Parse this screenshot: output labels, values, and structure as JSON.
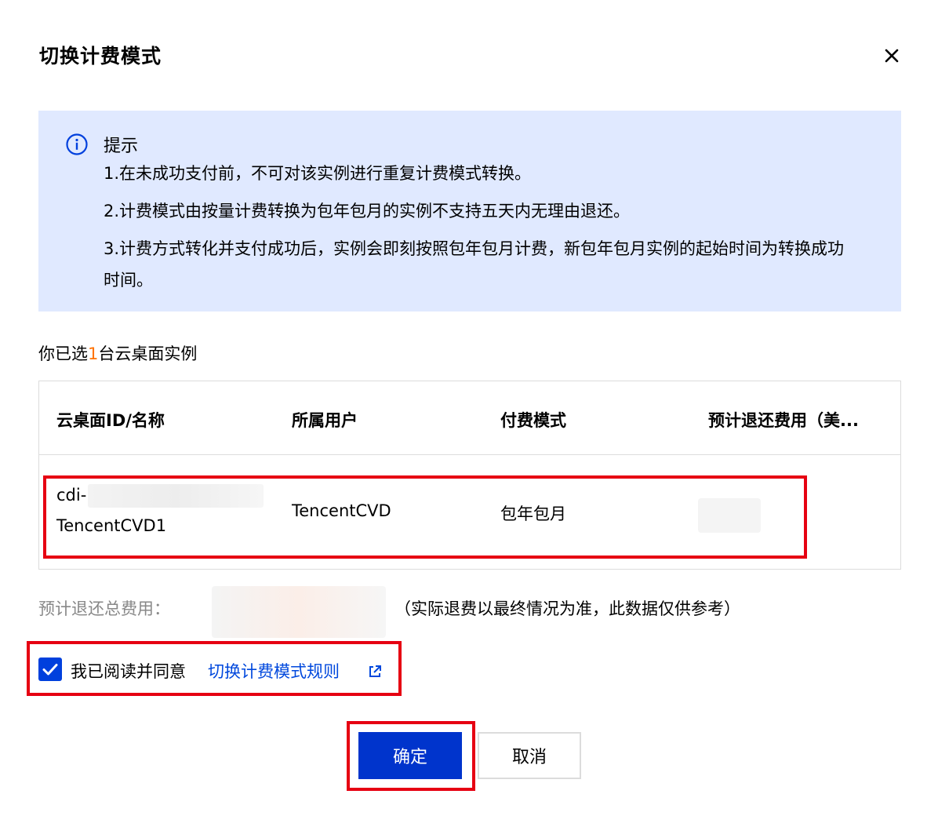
{
  "dialog": {
    "title": "切换计费模式",
    "close_icon": "close-icon"
  },
  "notice": {
    "icon": "info-icon",
    "title": "提示",
    "lines": [
      "1.在未成功支付前，不可对该实例进行重复计费模式转换。",
      "2.计费模式由按量计费转换为包年包月的实例不支持五天内无理由退还。",
      "3.计费方式转化并支付成功后，实例会即刻按照包年包月计费，新包年包月实例的起始时间为转换成功时间。"
    ],
    "background": "#e0e9ff"
  },
  "selection": {
    "prefix": "你已选",
    "count": "1",
    "suffix": "台云桌面实例",
    "count_color": "#ff7200"
  },
  "table": {
    "columns": [
      "云桌面ID/名称",
      "所属用户",
      "付费模式",
      "预计退还费用（美..."
    ],
    "rows": [
      {
        "id": "cdi-",
        "name": "TencentCVD1",
        "user": "TencentCVD",
        "billing_mode": "包年包月",
        "refund": ""
      }
    ]
  },
  "total": {
    "label": "预计退还总费用：",
    "note": "（实际退费以最终情况为准，此数据仅供参考）"
  },
  "agreement": {
    "checked": true,
    "text": "我已阅读并同意",
    "link_text": "切换计费模式规则",
    "link_icon": "external-link-icon"
  },
  "buttons": {
    "confirm": "确定",
    "cancel": "取消"
  },
  "colors": {
    "primary": "#0034cc",
    "link": "#0048dd",
    "highlight": "#e60012"
  }
}
